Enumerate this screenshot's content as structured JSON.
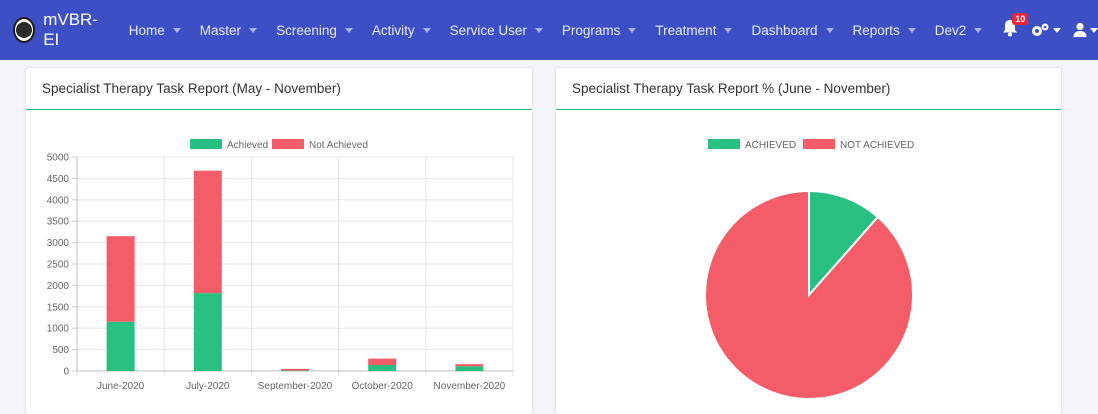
{
  "nav": {
    "brand": "mVBR-EI",
    "items": [
      {
        "label": "Home"
      },
      {
        "label": "Master"
      },
      {
        "label": "Screening"
      },
      {
        "label": "Activity"
      },
      {
        "label": "Service User"
      },
      {
        "label": "Programs"
      },
      {
        "label": "Treatment"
      },
      {
        "label": "Dashboard"
      },
      {
        "label": "Reports"
      },
      {
        "label": "Dev2"
      }
    ],
    "notification_count": "10",
    "icons": [
      "bell-icon",
      "gears-icon",
      "user-icon"
    ]
  },
  "colors": {
    "navbar": "#3c4fc4",
    "achieved": "#28c081",
    "not_achieved": "#f45d68",
    "header_rule": "#2eb37a"
  },
  "cards": [
    {
      "title": "Specialist Therapy Task Report (May - November)"
    },
    {
      "title": "Specialist Therapy Task Report % (June - November)"
    }
  ],
  "chart_data": [
    {
      "type": "bar",
      "stacked": true,
      "categories": [
        "June-2020",
        "July-2020",
        "September-2020",
        "October-2020",
        "November-2020"
      ],
      "series": [
        {
          "name": "Achieved",
          "color": "#28c081",
          "values": [
            1150,
            1820,
            10,
            140,
            110
          ]
        },
        {
          "name": "Not Achieved",
          "color": "#f45d68",
          "values": [
            2000,
            2860,
            40,
            150,
            50
          ]
        }
      ],
      "ylim": [
        0,
        5000
      ],
      "yticks": [
        0,
        500,
        1000,
        1500,
        2000,
        2500,
        3000,
        3500,
        4000,
        4500,
        5000
      ],
      "legend": "top",
      "grid": true
    },
    {
      "type": "pie",
      "labels": [
        "ACHIEVED",
        "NOT ACHIEVED"
      ],
      "values": [
        11.5,
        88.5
      ],
      "colors": [
        "#28c081",
        "#f45d68"
      ],
      "legend": "top"
    }
  ]
}
